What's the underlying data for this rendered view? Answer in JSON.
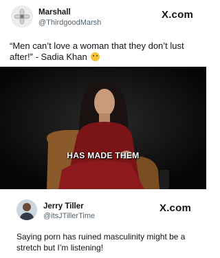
{
  "post1": {
    "author_name": "Marshall",
    "author_handle": "@ThirdgoodMarsh",
    "platform_logo": "X.com",
    "text": "“Men can’t love a woman that they don’t lust after!” - Sadia Khan",
    "emoji": "astonished-face-emoji",
    "media_caption": "HAS MADE THEM"
  },
  "post2": {
    "author_name": "Jerry Tiller",
    "author_handle": "@itsJTillerTime",
    "platform_logo": "X.com",
    "text": "Saying porn has ruined masculinity might be a stretch but I’m listening!"
  },
  "colors": {
    "background": "#ffffff",
    "text": "#0f1419",
    "handle": "#536471",
    "media_bg": "#0b0b0b",
    "dress": "#7a1416",
    "chair": "#8a5a2b"
  }
}
